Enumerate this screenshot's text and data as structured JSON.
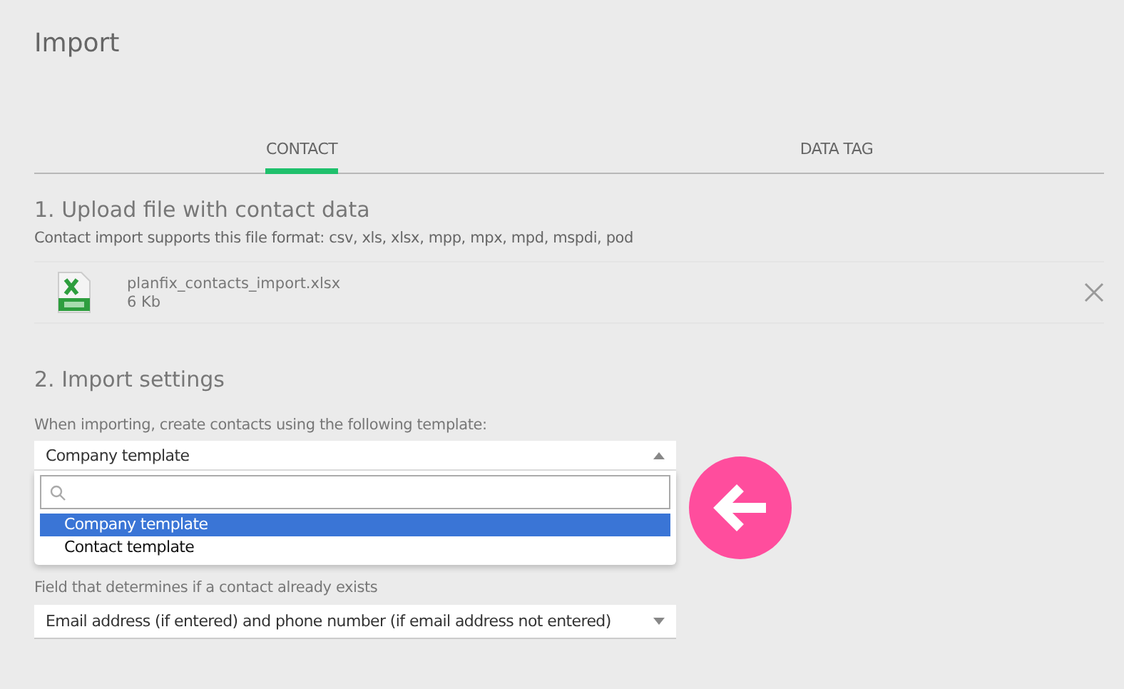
{
  "title": "Import",
  "tabs": [
    {
      "label": "CONTACT",
      "selected": true
    },
    {
      "label": "DATA TAG",
      "selected": false
    }
  ],
  "upload": {
    "heading": "1. Upload file with contact data",
    "note": "Contact import supports this file format: csv, xls, xlsx, mpp, mpx, mpd, mspdi, pod",
    "file": {
      "name": "planfix_contacts_import.xlsx",
      "size": "6 Kb"
    }
  },
  "settings": {
    "heading": "2. Import settings",
    "template_label": "When importing, create contacts using the following template:",
    "template_select": {
      "value": "Company template",
      "expanded": true,
      "options": [
        {
          "label": "Company template",
          "selected": true
        },
        {
          "label": "Contact template",
          "selected": false
        }
      ]
    },
    "exists_label": "Field that determines if a contact already exists",
    "exists_select": {
      "value": "Email address (if entered) and phone number (if email address not entered)"
    }
  }
}
